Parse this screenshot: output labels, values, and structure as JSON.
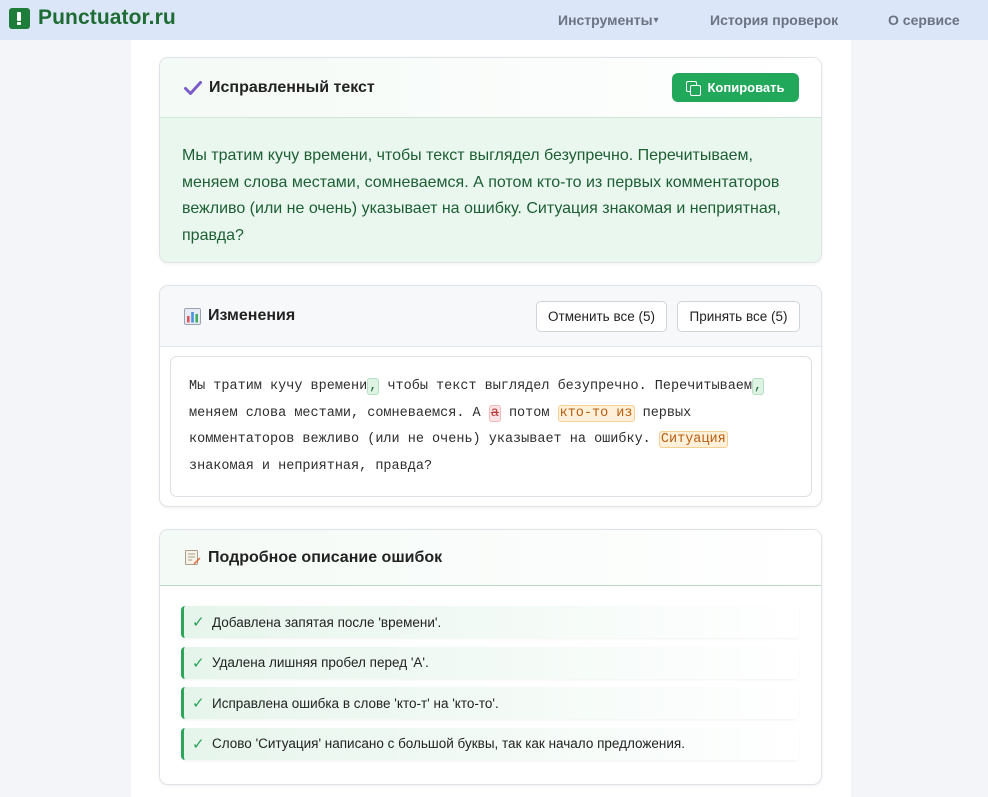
{
  "header": {
    "logo_text": "Punctuator.ru",
    "nav": [
      {
        "label": "Инструменты",
        "caret": "▾"
      },
      {
        "label": "История проверок"
      },
      {
        "label": "О сервисе"
      }
    ]
  },
  "corrected": {
    "title": "Исправленный текст",
    "copy_label": "Копировать",
    "text": "Мы тратим кучу времени, чтобы текст выглядел безупречно. Перечитываем, меняем слова местами, сомневаемся. А потом кто-то из первых комментаторов вежливо (или не очень) указывает на ошибку. Ситуация знакомая и неприятная, правда?"
  },
  "changes": {
    "title": "Изменения",
    "undo_all": "Отменить все (5)",
    "accept_all": "Принять все (5)",
    "diff": {
      "t1": "Мы тратим кучу времени",
      "ins1": ",",
      "t2": " чтобы текст выглядел безупречно. Перечитываем",
      "ins2": ",",
      "t3": " меняем слова местами, сомневаемся. А ",
      "del1": "а",
      "t4": " потом ",
      "fix1": "кто-то из",
      "t5": " первых комментаторов вежливо (или не очень) указывает на ошибку. ",
      "fix2": "Ситуация",
      "t6": " знакомая и неприятная, правда?"
    }
  },
  "details": {
    "title": "Подробное описание ошибок",
    "check_symbol": "✓",
    "items": [
      "Добавлена запятая после 'времени'.",
      "Удалена лишняя пробел перед 'А'.",
      "Исправлена ошибка в слове 'кто-т' на 'кто-то'.",
      "Слово 'Ситуация' написано с большой буквы, так как начало предложения."
    ]
  },
  "colors": {
    "header_bg": "#dbe6f9",
    "brand_green": "#1e6b34",
    "copy_button": "#22a85a",
    "corrected_bg": "#e9f7ee"
  }
}
